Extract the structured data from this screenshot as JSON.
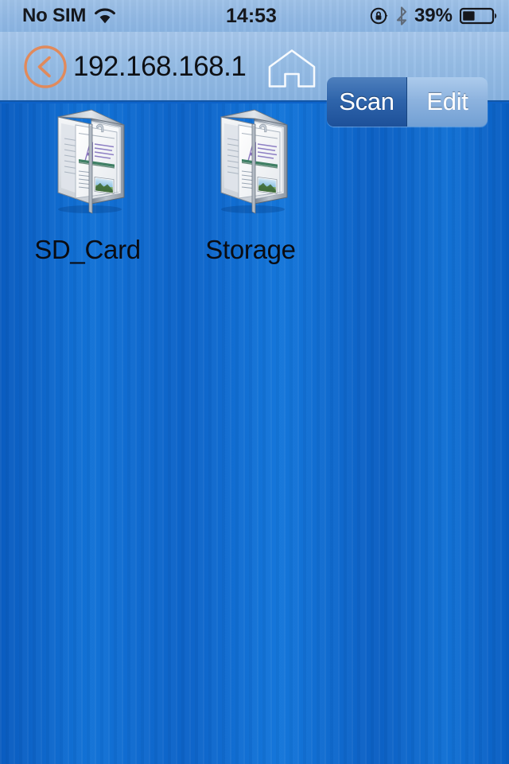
{
  "status_bar": {
    "carrier": "No SIM",
    "wifi_icon": "wifi-icon",
    "time": "14:53",
    "rotation_lock_icon": "rotation-lock-icon",
    "bluetooth_icon": "bluetooth-icon",
    "battery_percent": "39%",
    "battery_level": 39,
    "battery_icon": "battery-icon"
  },
  "nav_bar": {
    "back_icon": "back-chevron-circle-icon",
    "back_color": "#e08a5c",
    "title": "192.168.168.1",
    "home_icon": "home-icon",
    "segmented": {
      "options": [
        {
          "label": "Scan",
          "selected": true
        },
        {
          "label": "Edit",
          "selected": false
        }
      ]
    }
  },
  "content": {
    "background_color": "#0d63c8",
    "files": [
      {
        "label": "SD_Card",
        "icon": "documents-folder-icon"
      },
      {
        "label": "Storage",
        "icon": "documents-folder-icon"
      }
    ]
  }
}
